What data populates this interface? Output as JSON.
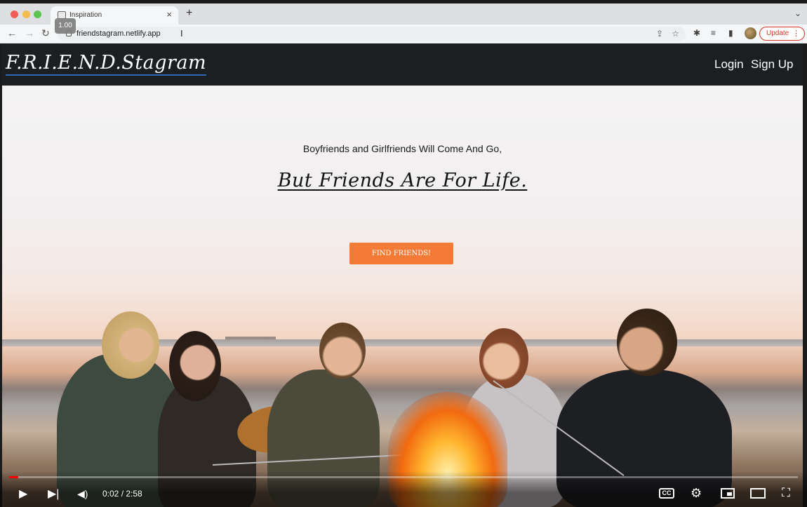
{
  "browser": {
    "tab_title": "Inspiration",
    "new_tab": "+",
    "tab_close": "×",
    "tab_menu": "⌄",
    "zoom_badge": "1.00",
    "url": "friendstagram.netlify.app",
    "update_label": "Update",
    "update_more": "⋮"
  },
  "site": {
    "logo": "F.R.I.E.N.D.Stagram",
    "nav_login": "Login",
    "nav_signup": "Sign Up"
  },
  "hero": {
    "tagline": "Boyfriends and Girlfriends Will Come And Go,",
    "motto": "But Friends Are For Life.",
    "cta_label": "FIND FRIENDS!"
  },
  "video": {
    "time": "0:02 / 2:58",
    "progress_fraction": 0.0112,
    "cc_label": "CC",
    "progress_color": "#ff0000"
  },
  "colors": {
    "nav_bg": "#1c1f22",
    "cta_bg": "#f47b35",
    "logo_underline": "#2e69b3"
  },
  "icons": [
    "back-icon",
    "forward-icon",
    "reload-icon",
    "lock-icon",
    "share-icon",
    "star-icon",
    "extensions-icon",
    "reading-list-icon",
    "sidebar-icon",
    "play-icon",
    "next-icon",
    "volume-icon",
    "settings-icon",
    "miniplayer-icon",
    "theater-icon",
    "fullscreen-icon"
  ]
}
